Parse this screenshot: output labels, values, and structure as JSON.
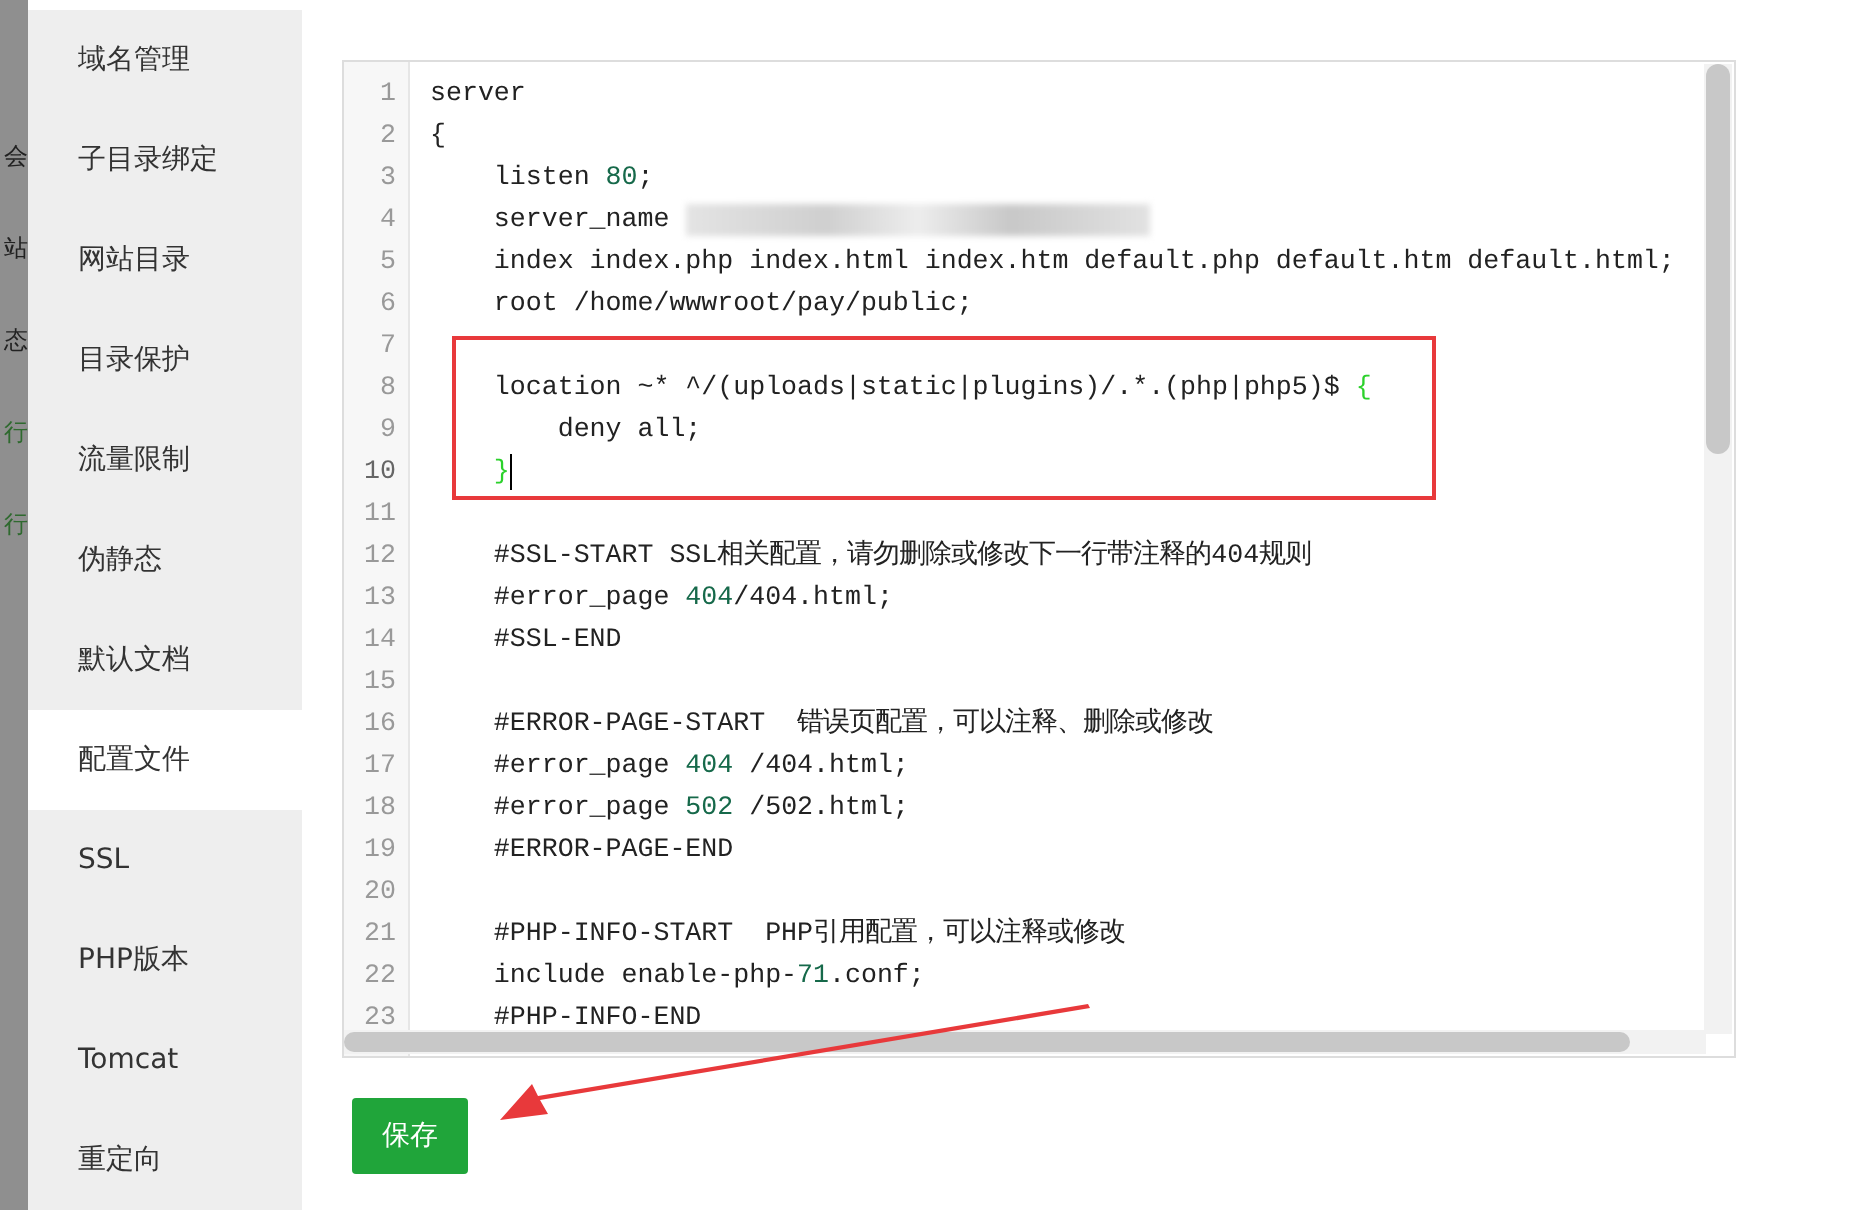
{
  "background_page": {
    "row_texts": [
      {
        "text": "会",
        "kind": "plain"
      },
      {
        "text": "站",
        "kind": "plain"
      },
      {
        "text": "态",
        "kind": "plain"
      },
      {
        "text": "行",
        "kind": "status"
      },
      {
        "text": "行",
        "kind": "status"
      }
    ]
  },
  "sidebar": {
    "items": [
      {
        "label": "域名管理",
        "selected": false
      },
      {
        "label": "子目录绑定",
        "selected": false
      },
      {
        "label": "网站目录",
        "selected": false
      },
      {
        "label": "目录保护",
        "selected": false
      },
      {
        "label": "流量限制",
        "selected": false
      },
      {
        "label": "伪静态",
        "selected": false
      },
      {
        "label": "默认文档",
        "selected": false
      },
      {
        "label": "配置文件",
        "selected": true
      },
      {
        "label": "SSL",
        "selected": false
      },
      {
        "label": "PHP版本",
        "selected": false
      },
      {
        "label": "Tomcat",
        "selected": false
      },
      {
        "label": "重定向",
        "selected": false
      }
    ]
  },
  "editor": {
    "lines": [
      {
        "number": "1",
        "cursor": false,
        "segments": [
          {
            "kind": "plain",
            "text": "server"
          }
        ]
      },
      {
        "number": "2",
        "cursor": false,
        "segments": [
          {
            "kind": "plain",
            "text": "{"
          }
        ]
      },
      {
        "number": "3",
        "cursor": false,
        "segments": [
          {
            "kind": "plain",
            "text": "    listen "
          },
          {
            "kind": "number",
            "text": "80"
          },
          {
            "kind": "plain",
            "text": ";"
          }
        ]
      },
      {
        "number": "4",
        "cursor": false,
        "segments": [
          {
            "kind": "plain",
            "text": "    server_name "
          },
          {
            "kind": "redacted"
          }
        ]
      },
      {
        "number": "5",
        "cursor": false,
        "segments": [
          {
            "kind": "plain",
            "text": "    index index.php index.html index.htm default.php default.htm default.html;"
          }
        ]
      },
      {
        "number": "6",
        "cursor": false,
        "segments": [
          {
            "kind": "plain",
            "text": "    root /home/wwwroot/pay/public;"
          }
        ]
      },
      {
        "number": "7",
        "cursor": false
      },
      {
        "number": "8",
        "cursor": false,
        "segments": [
          {
            "kind": "plain",
            "text": "    location ~* ^/(uploads|static|plugins)/.*.(php|php5)$ "
          },
          {
            "kind": "bracket",
            "text": "{"
          }
        ]
      },
      {
        "number": "9",
        "cursor": false,
        "segments": [
          {
            "kind": "plain",
            "text": "        deny all;"
          }
        ]
      },
      {
        "number": "10",
        "cursor": true,
        "segments": [
          {
            "kind": "bracket",
            "text": "    }"
          }
        ]
      },
      {
        "number": "11",
        "cursor": false
      },
      {
        "number": "12",
        "cursor": false,
        "segments": [
          {
            "kind": "plain",
            "text": "    #SSL-START SSL相关配置，请勿删除或修改下一行带注释的404规则"
          }
        ]
      },
      {
        "number": "13",
        "cursor": false,
        "segments": [
          {
            "kind": "plain",
            "text": "    #error_page "
          },
          {
            "kind": "number",
            "text": "404"
          },
          {
            "kind": "plain",
            "text": "/404.html;"
          }
        ]
      },
      {
        "number": "14",
        "cursor": false,
        "segments": [
          {
            "kind": "plain",
            "text": "    #SSL-END"
          }
        ]
      },
      {
        "number": "15",
        "cursor": false
      },
      {
        "number": "16",
        "cursor": false,
        "segments": [
          {
            "kind": "plain",
            "text": "    #ERROR-PAGE-START  错误页配置，可以注释、删除或修改"
          }
        ]
      },
      {
        "number": "17",
        "cursor": false,
        "segments": [
          {
            "kind": "plain",
            "text": "    #error_page "
          },
          {
            "kind": "number",
            "text": "404"
          },
          {
            "kind": "plain",
            "text": " /404.html;"
          }
        ]
      },
      {
        "number": "18",
        "cursor": false,
        "segments": [
          {
            "kind": "plain",
            "text": "    #error_page "
          },
          {
            "kind": "number",
            "text": "502"
          },
          {
            "kind": "plain",
            "text": " /502.html;"
          }
        ]
      },
      {
        "number": "19",
        "cursor": false,
        "segments": [
          {
            "kind": "plain",
            "text": "    #ERROR-PAGE-END"
          }
        ]
      },
      {
        "number": "20",
        "cursor": false
      },
      {
        "number": "21",
        "cursor": false,
        "segments": [
          {
            "kind": "plain",
            "text": "    #PHP-INFO-START  PHP引用配置，可以注释或修改"
          }
        ]
      },
      {
        "number": "22",
        "cursor": false,
        "segments": [
          {
            "kind": "plain",
            "text": "    include enable-php-"
          },
          {
            "kind": "number",
            "text": "71"
          },
          {
            "kind": "plain",
            "text": ".conf;"
          }
        ]
      },
      {
        "number": "23",
        "cursor": false,
        "segments": [
          {
            "kind": "plain",
            "text": "    #PHP-INFO-END"
          }
        ]
      }
    ]
  },
  "save_button": {
    "label": "保存"
  }
}
